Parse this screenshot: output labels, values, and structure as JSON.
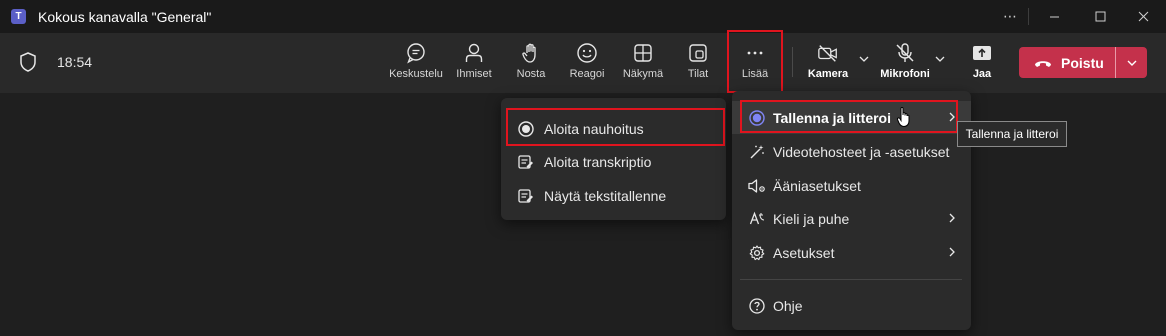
{
  "window": {
    "app_icon": "teams-logo",
    "title": "Kokous kanavalla \"General\"",
    "controls": [
      "more-icon",
      "minimize-icon",
      "maximize-icon",
      "close-icon"
    ]
  },
  "toolbar": {
    "time": "18:54",
    "buttons": {
      "chat": "Keskustelu",
      "people": "Ihmiset",
      "raise": "Nosta",
      "react": "Reagoi",
      "view": "Näkymä",
      "rooms": "Tilat",
      "more": "Lisää",
      "camera": "Kamera",
      "mic": "Mikrofoni",
      "share": "Jaa"
    },
    "leave_label": "Poistu",
    "leave_color": "#c4314b"
  },
  "more_menu": {
    "items": [
      {
        "label": "Tallenna ja litteroi",
        "icon": "record-icon",
        "submenu": true
      },
      {
        "label": "Videotehosteet ja -asetukset",
        "icon": "wand-icon",
        "submenu": false
      },
      {
        "label": "Ääniasetukset",
        "icon": "speaker-settings-icon",
        "submenu": false
      },
      {
        "label": "Kieli ja puhe",
        "icon": "language-icon",
        "submenu": true
      },
      {
        "label": "Asetukset",
        "icon": "gear-icon",
        "submenu": true
      },
      {
        "label": "Ohje",
        "icon": "help-icon",
        "submenu": false
      }
    ]
  },
  "record_submenu": {
    "items": [
      {
        "label": "Aloita nauhoitus",
        "icon": "record-icon"
      },
      {
        "label": "Aloita transkriptio",
        "icon": "transcript-icon"
      },
      {
        "label": "Näytä tekstitallenne",
        "icon": "transcript-view-icon"
      }
    ]
  },
  "tooltip": "Tallenna ja litteroi",
  "colors": {
    "accent": "#7f85f5",
    "highlight_box": "#e0141e",
    "background": "#1f1f1f",
    "toolbar": "#292929"
  }
}
